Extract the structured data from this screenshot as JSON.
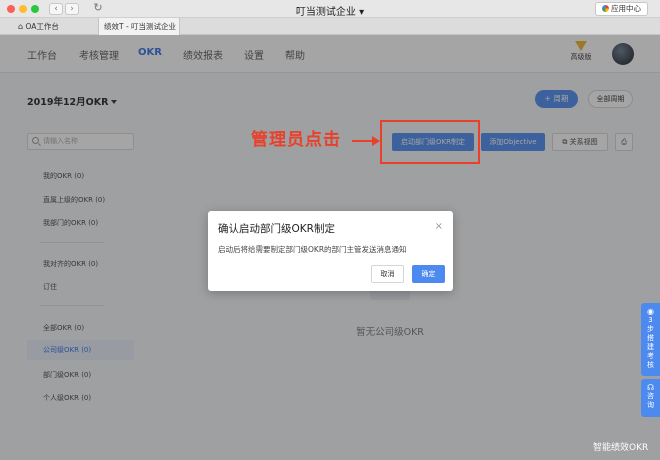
{
  "window": {
    "title": "叮当测试企业",
    "app_center": "应用中心"
  },
  "tabs": [
    {
      "label": "OA工作台"
    },
    {
      "label": "绩效T - 叮当测试企业"
    }
  ],
  "nav": {
    "items": [
      "工作台",
      "考核管理",
      "OKR",
      "绩效报表",
      "设置",
      "帮助"
    ],
    "active": "OKR",
    "plan_label": "高级版"
  },
  "period": {
    "label": "2019年12月OKR"
  },
  "header_buttons": {
    "add_week": "+ 周期",
    "all_weeks": "全部周期"
  },
  "sidebar": {
    "search_placeholder": "请输入名称",
    "group1": [
      {
        "label": "我的OKR",
        "count": "(0)"
      },
      {
        "label": "直属上级的OKR",
        "count": "(0)"
      },
      {
        "label": "我部门的OKR",
        "count": "(0)"
      }
    ],
    "group2": [
      {
        "label": "我对齐的OKR",
        "count": "(0)"
      },
      {
        "label": "订住",
        "count": ""
      }
    ],
    "group3": [
      {
        "label": "全部OKR",
        "count": "(0)"
      },
      {
        "label": "公司级OKR",
        "count": "(0)"
      },
      {
        "label": "部门级OKR",
        "count": "(0)"
      },
      {
        "label": "个人级OKR",
        "count": "(0)"
      }
    ],
    "active_item": "公司级OKR"
  },
  "toolbar": {
    "start_dept": "启动部门级OKR制定",
    "add_objective": "添加Objective",
    "relation_view": "关系视图",
    "print": "print-icon"
  },
  "empty_state": {
    "text": "暂无公司级OKR"
  },
  "annotation": {
    "text": "管理员点击",
    "color": "#e8402a"
  },
  "modal": {
    "title": "确认启动部门级OKR制定",
    "body": "启动后将给需要制定部门级OKR的部门主管发送消息通知",
    "cancel": "取消",
    "confirm": "确定"
  },
  "float": {
    "guide": "3步搭建考核",
    "help": "咨询"
  },
  "watermark": "智能绩效OKR",
  "colors": {
    "accent": "#4d8af0",
    "active_nav": "#2f6ee5"
  }
}
